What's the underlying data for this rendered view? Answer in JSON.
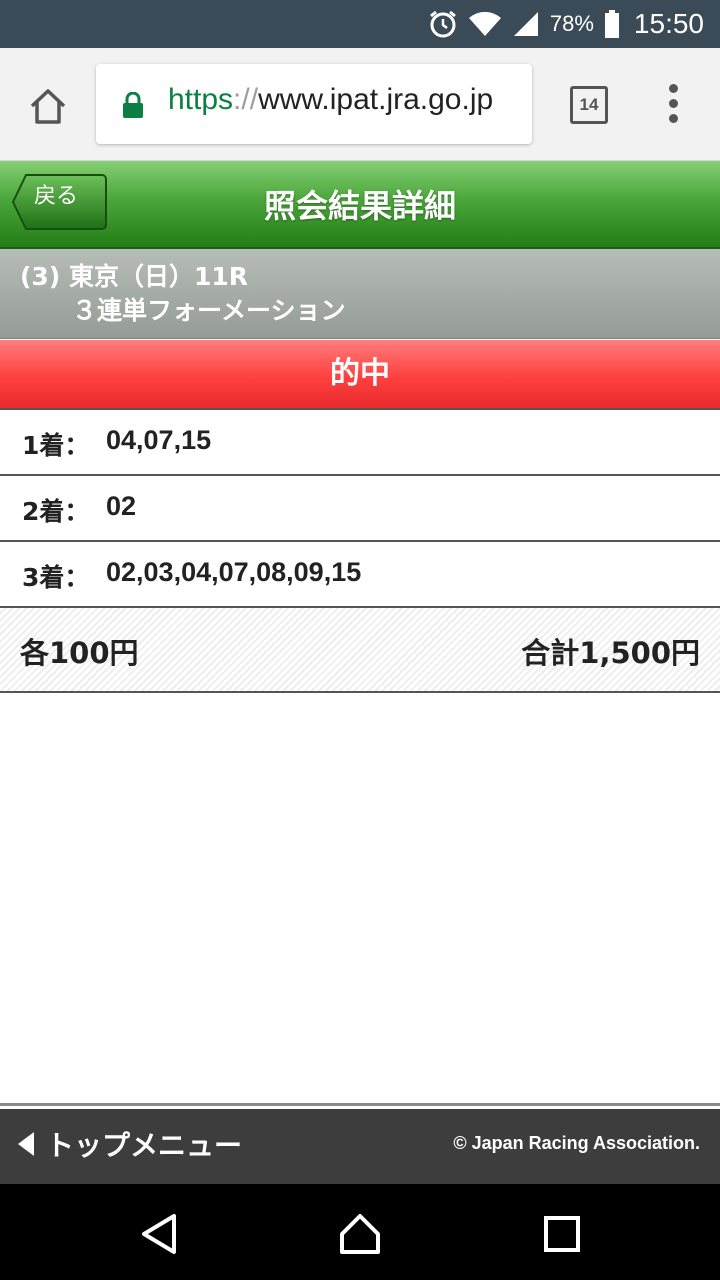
{
  "status_bar": {
    "battery": "78%",
    "time": "15:50"
  },
  "browser": {
    "url_scheme": "https",
    "url_sep": "://",
    "url_host": "www.ipat.jra.go.jp",
    "tab_count": "14"
  },
  "header": {
    "back_label": "戻る",
    "title": "照会結果詳細"
  },
  "race": {
    "line1": "(3) 東京（日）11R",
    "line2": "３連単フォーメーション"
  },
  "result": {
    "banner": "的中"
  },
  "picks": [
    {
      "label": "1着：",
      "value": "04,07,15"
    },
    {
      "label": "2着：",
      "value": "02"
    },
    {
      "label": "3着：",
      "value": "02,03,04,07,08,09,15"
    }
  ],
  "totals": {
    "each": "各100円",
    "total": "合計1,500円"
  },
  "footer": {
    "top_menu": "トップメニュー",
    "copyright": "© Japan Racing Association."
  },
  "icons": {
    "alarm": "alarm-icon",
    "wifi": "wifi-icon",
    "signal": "signal-icon",
    "battery": "battery-icon",
    "home": "home-icon",
    "lock": "lock-icon",
    "more": "more-vert-icon",
    "back": "back-triangle-icon",
    "nav_home": "circle-home-icon",
    "recents": "square-recents-icon"
  },
  "colors": {
    "header_green": "#2e8b1f",
    "hit_red": "#ff4040",
    "race_gray": "#a3a9a3",
    "footer_dark": "#3d3d3d",
    "url_green": "#0b8043"
  }
}
